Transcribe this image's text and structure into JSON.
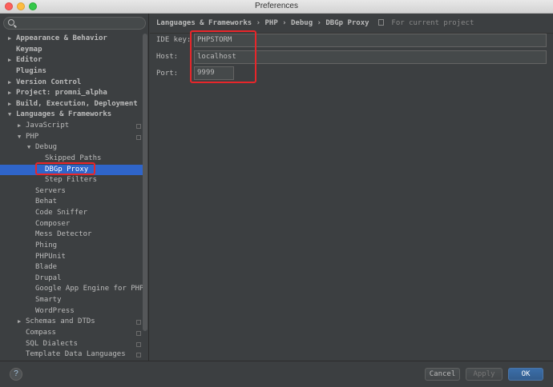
{
  "window": {
    "title": "Preferences"
  },
  "search": {
    "placeholder": ""
  },
  "tree": [
    {
      "label": "Appearance & Behavior",
      "arrow": "▶",
      "bold": true
    },
    {
      "label": "Keymap",
      "arrow": "",
      "bold": true
    },
    {
      "label": "Editor",
      "arrow": "▶",
      "bold": true
    },
    {
      "label": "Plugins",
      "arrow": "",
      "bold": true
    },
    {
      "label": "Version Control",
      "arrow": "▶",
      "bold": true
    },
    {
      "label": "Project: promni_alpha",
      "arrow": "▶",
      "bold": true
    },
    {
      "label": "Build, Execution, Deployment",
      "arrow": "▶",
      "bold": true
    },
    {
      "label": "Languages & Frameworks",
      "arrow": "▼",
      "bold": true
    },
    {
      "label": "JavaScript",
      "arrow": "▶",
      "bold": false
    },
    {
      "label": "PHP",
      "arrow": "▼",
      "bold": false
    },
    {
      "label": "Debug",
      "arrow": "▼",
      "bold": false
    },
    {
      "label": "Skipped Paths",
      "arrow": "",
      "bold": false
    },
    {
      "label": "DBGp Proxy",
      "arrow": "",
      "bold": false
    },
    {
      "label": "Step Filters",
      "arrow": "",
      "bold": false
    },
    {
      "label": "Servers",
      "arrow": "",
      "bold": false
    },
    {
      "label": "Behat",
      "arrow": "",
      "bold": false
    },
    {
      "label": "Code Sniffer",
      "arrow": "",
      "bold": false
    },
    {
      "label": "Composer",
      "arrow": "",
      "bold": false
    },
    {
      "label": "Mess Detector",
      "arrow": "",
      "bold": false
    },
    {
      "label": "Phing",
      "arrow": "",
      "bold": false
    },
    {
      "label": "PHPUnit",
      "arrow": "",
      "bold": false
    },
    {
      "label": "Blade",
      "arrow": "",
      "bold": false
    },
    {
      "label": "Drupal",
      "arrow": "",
      "bold": false
    },
    {
      "label": "Google App Engine for PHP",
      "arrow": "",
      "bold": false
    },
    {
      "label": "Smarty",
      "arrow": "",
      "bold": false
    },
    {
      "label": "WordPress",
      "arrow": "",
      "bold": false
    },
    {
      "label": "Schemas and DTDs",
      "arrow": "▶",
      "bold": false
    },
    {
      "label": "Compass",
      "arrow": "",
      "bold": false
    },
    {
      "label": "SQL Dialects",
      "arrow": "",
      "bold": false
    },
    {
      "label": "Template Data Languages",
      "arrow": "",
      "bold": false
    }
  ],
  "breadcrumb": {
    "items": [
      "Languages & Frameworks",
      "PHP",
      "Debug",
      "DBGp Proxy"
    ],
    "separator": "›",
    "hint": "For current project"
  },
  "form": {
    "ide_key_label": "IDE key:",
    "ide_key_value": "PHPSTORM",
    "host_label": "Host:",
    "host_value": "localhost",
    "port_label": "Port:",
    "port_value": "9999"
  },
  "buttons": {
    "help": "?",
    "cancel": "Cancel",
    "apply": "Apply",
    "ok": "OK"
  },
  "colors": {
    "selection": "#2f65ca",
    "highlight": "#e8262a",
    "background": "#3c3f41"
  }
}
